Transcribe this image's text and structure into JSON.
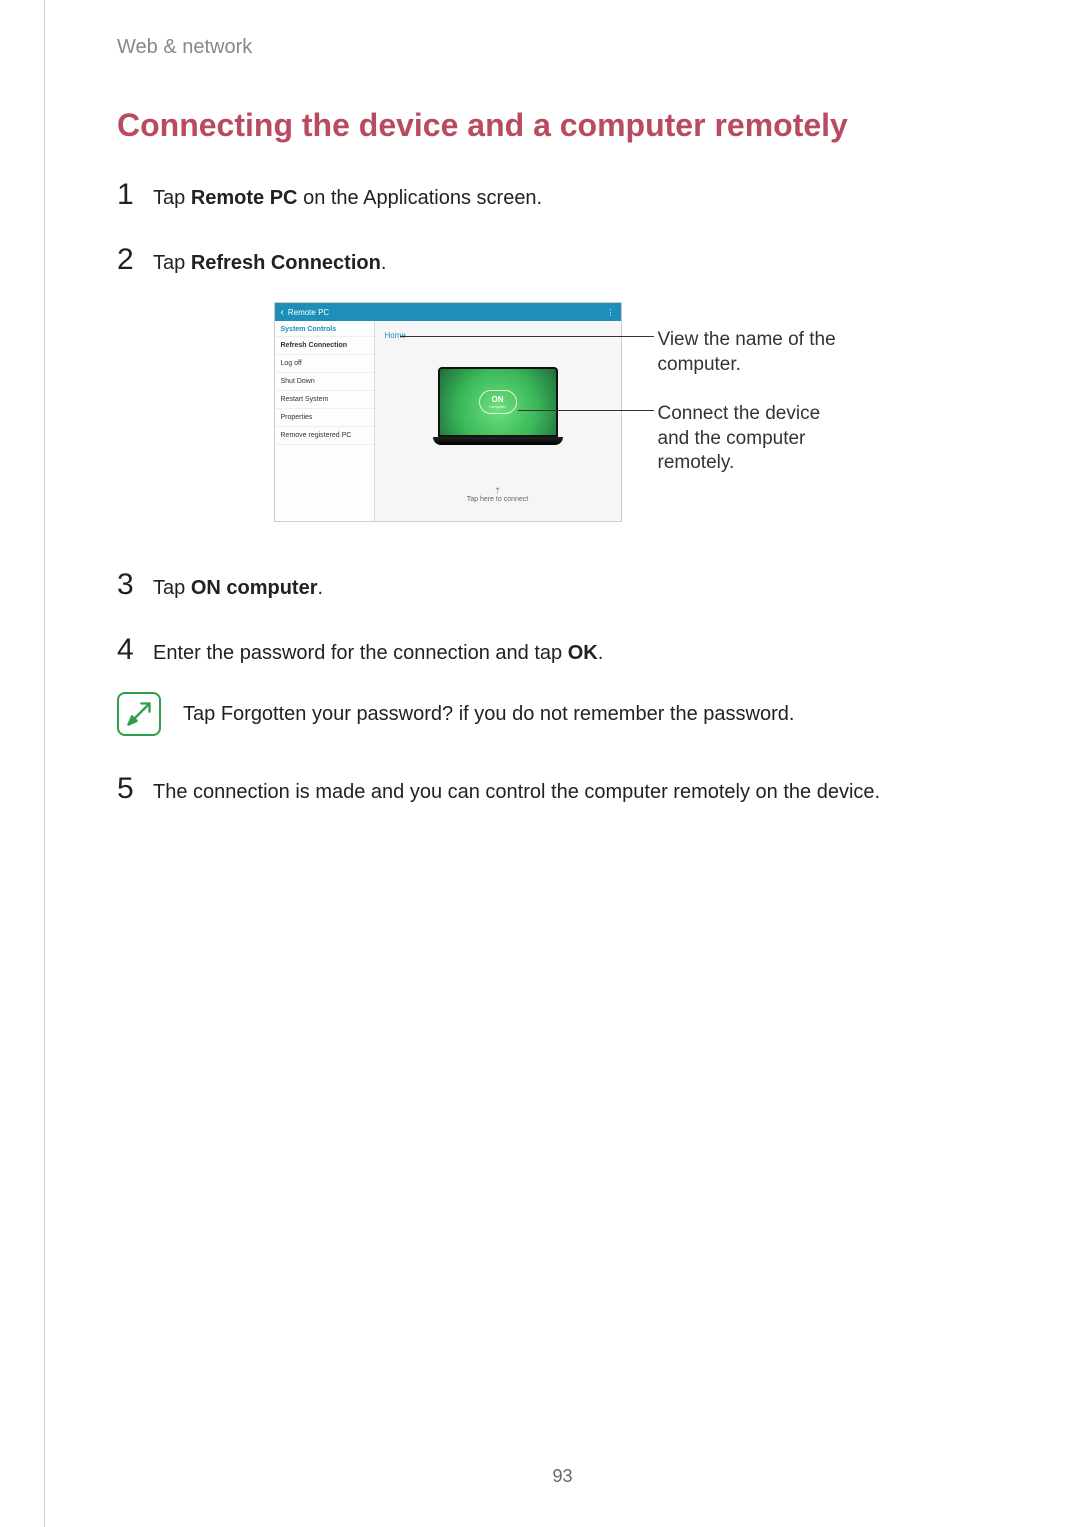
{
  "breadcrumb": "Web & network",
  "title": "Connecting the device and a computer remotely",
  "steps": {
    "s1_pre": "Tap ",
    "s1_bold": "Remote PC",
    "s1_post": " on the Applications screen.",
    "s2_pre": "Tap ",
    "s2_bold": "Refresh Connection",
    "s2_post": ".",
    "s3_pre": "Tap ",
    "s3_bold": "ON computer",
    "s3_post": ".",
    "s4_pre": "Enter the password for the connection and tap ",
    "s4_bold": "OK",
    "s4_post": ".",
    "s5": "The connection is made and you can control the computer remotely on the device."
  },
  "note": {
    "pre": "Tap ",
    "bold": "Forgotten your password?",
    "post": " if you do not remember the password."
  },
  "screenshot": {
    "header_title": "Remote PC",
    "sidebar_heading": "System Controls",
    "sidebar_items": [
      "Refresh Connection",
      "Log off",
      "Shut Down",
      "Restart System",
      "Properties",
      "Remove registered PC"
    ],
    "home_label": "Home",
    "on_label": "ON",
    "on_sub": "computer",
    "tap_connect": "Tap here to connect"
  },
  "callouts": {
    "c1": "View the name of the computer.",
    "c2": "Connect the device and the computer remotely."
  },
  "page_number": "93"
}
